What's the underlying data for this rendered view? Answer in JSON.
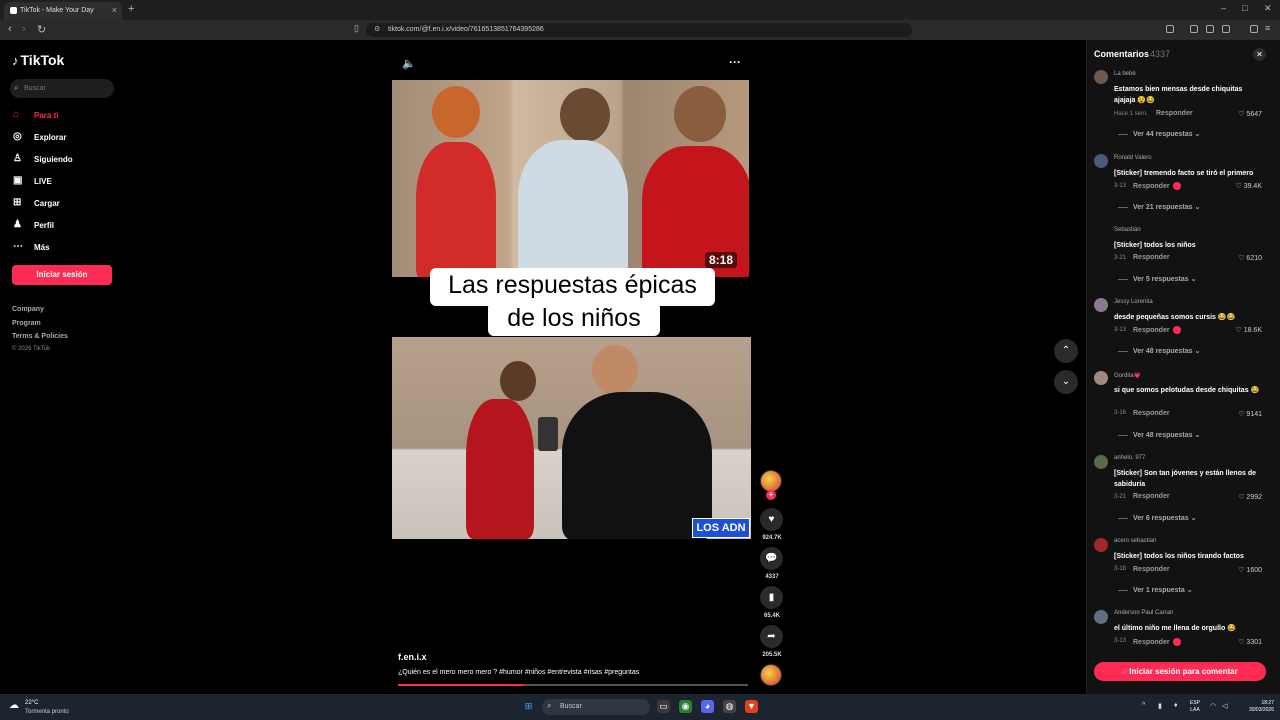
{
  "browser": {
    "tab_title": "TikTok - Make Your Day",
    "url": "tiktok.com/@f.en.i.x/video/7616513851764395286"
  },
  "sidebar": {
    "logo": "TikTok",
    "search_placeholder": "Buscar",
    "items": [
      {
        "label": "Para ti",
        "icon": "home-icon"
      },
      {
        "label": "Explorar",
        "icon": "compass-icon"
      },
      {
        "label": "Siguiendo",
        "icon": "following-icon"
      },
      {
        "label": "LIVE",
        "icon": "live-icon"
      },
      {
        "label": "Cargar",
        "icon": "upload-icon"
      },
      {
        "label": "Perfil",
        "icon": "profile-icon"
      },
      {
        "label": "Más",
        "icon": "more-icon"
      }
    ],
    "login_button": "Iniciar sesión",
    "footer": [
      "Company",
      "Program",
      "Terms & Policies"
    ],
    "copyright": "© 2026 TikTok"
  },
  "video": {
    "duration_badge": "8:18",
    "caption_line1": "Las respuestas épicas",
    "caption_line2": "de los niños",
    "brand_badge": "LOS ADN",
    "author": "f.en.i.x",
    "description": "¿Quién es el mero mero mero ? #humor #niños #entrevista #risas #preguntas",
    "progress": 0.36
  },
  "actions": {
    "likes": "924.7K",
    "comments": "4337",
    "saves": "65.4K",
    "shares": "205.5K"
  },
  "comments_panel": {
    "title": "Comentarios",
    "count": "4337",
    "reply_label": "Responder",
    "login_button": "Iniciar sesión para comentar",
    "comments": [
      {
        "user": "La bebé",
        "text": "Estamos bien mensas desde chiquitas ajajaja 😵😂",
        "date": "Hace 1 sem.",
        "likes": "5647",
        "more": "Ver 44 respuestas"
      },
      {
        "user": "Ronald Valero",
        "text": "[Sticker] tremendo facto se tiró el primero",
        "date": "3-13",
        "likes": "39.4K",
        "more": "Ver 21 respuestas"
      },
      {
        "user": "Sebastián",
        "text": "[Sticker] todos los niños",
        "date": "3-21",
        "likes": "6210",
        "more": "Ver 5 respuestas"
      },
      {
        "user": "Jessy Lorenita",
        "text": "desde pequeñas somos cursis 😂😂",
        "date": "3-13",
        "likes": "18.6K",
        "more": "Ver 48 respuestas"
      },
      {
        "user": "Gordita💗",
        "text": "si que somos pelotudas desde chiquitas 😂",
        "date": "3-16",
        "likes": "9141",
        "more": "Ver 48 respuestas"
      },
      {
        "user": "anhelo. 977",
        "text": "[Sticker] Son tan jóvenes y están llenos de sabiduría",
        "date": "3-21",
        "likes": "2992",
        "more": "Ver 6 respuestas"
      },
      {
        "user": "acero sebastian",
        "text": "[Sticker] todos los niños tirando factos",
        "date": "3-18",
        "likes": "1600",
        "more": "Ver 1 respuesta"
      },
      {
        "user": "Anderson Paul Carran",
        "text": "el último niño me llena de orgullo 😂",
        "date": "3-13",
        "likes": "3301",
        "more": ""
      }
    ]
  },
  "taskbar": {
    "temp": "22°C",
    "weather": "Tormenta pronto",
    "search": "Buscar",
    "lang1": "ESP",
    "lang2": "LAA",
    "time": "18:27",
    "date": "30/03/2026"
  },
  "colors": {
    "accent": "#fe2c55",
    "background": "#000000",
    "panel": "#121212"
  }
}
